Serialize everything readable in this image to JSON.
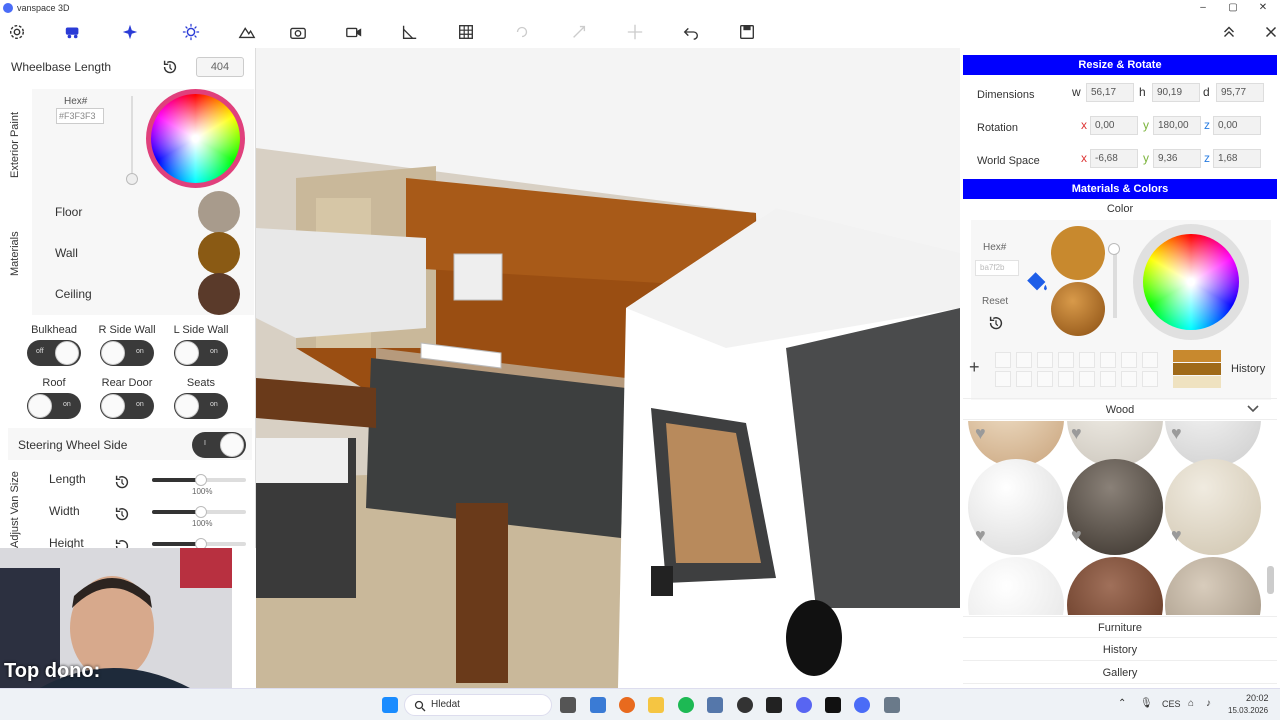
{
  "window": {
    "title": "vanspace 3D",
    "minimize": "–",
    "maximize": "▢",
    "close": "✕"
  },
  "toolbar": {
    "icons": [
      "settings-icon",
      "van-icon",
      "sparkle-icon",
      "sun-icon",
      "terrain-icon",
      "camera-icon",
      "video-icon",
      "measure-icon",
      "grid-icon",
      "redo-icon",
      "resize-icon",
      "move-icon",
      "undo-icon",
      "save-icon",
      "collapse-icon",
      "close-icon"
    ]
  },
  "left": {
    "wheelbase": {
      "label": "Wheelbase Length",
      "value": "404"
    },
    "exterior": {
      "section": "Exterior Paint",
      "hex_label": "Hex#",
      "hex_value": "#F3F3F3"
    },
    "materials": {
      "section": "Materials",
      "items": [
        {
          "label": "Floor",
          "color": "#a89b8c"
        },
        {
          "label": "Wall",
          "color": "#8a5a14"
        },
        {
          "label": "Ceiling",
          "color": "#5a3a2a"
        }
      ]
    },
    "toggles": [
      {
        "label": "Bulkhead",
        "state": "off"
      },
      {
        "label": "R Side Wall",
        "state": "on"
      },
      {
        "label": "L Side Wall",
        "state": "on"
      },
      {
        "label": "Roof",
        "state": "on"
      },
      {
        "label": "Rear Door",
        "state": "on"
      },
      {
        "label": "Seats",
        "state": "on"
      }
    ],
    "steering": {
      "label": "Steering Wheel Side",
      "knob": "I"
    },
    "size": {
      "section": "Adjust Van Size",
      "items": [
        {
          "label": "Length",
          "pct": "100%",
          "fraction": 1.0
        },
        {
          "label": "Width",
          "pct": "100%",
          "fraction": 1.0
        },
        {
          "label": "Height",
          "pct": "",
          "fraction": 1.0
        }
      ]
    }
  },
  "right": {
    "resize": {
      "title": "Resize & Rotate",
      "dimensions": {
        "label": "Dimensions",
        "w": "56,17",
        "h": "90,19",
        "d": "95,77"
      },
      "rotation": {
        "label": "Rotation",
        "x": "0,00",
        "y": "180,00",
        "z": "0,00"
      },
      "world": {
        "label": "World Space",
        "x": "-6,68",
        "y": "9,36",
        "z": "1,68"
      },
      "axes": {
        "w": "w",
        "h": "h",
        "d": "d",
        "x": "x",
        "y": "y",
        "z": "z"
      }
    },
    "materials": {
      "title": "Materials & Colors",
      "color_label": "Color",
      "hex_label": "Hex#",
      "hex_placeholder": "ba7f2b",
      "reset_label": "Reset",
      "plus": "+",
      "history_label": "History",
      "selected_color": "#c8892e"
    },
    "wood": {
      "label": "Wood"
    },
    "sections": {
      "furniture": "Furniture",
      "history": "History",
      "gallery": "Gallery"
    }
  },
  "webcam": {
    "overlay": "Top dono:"
  },
  "taskbar": {
    "search_placeholder": "Hledat",
    "lang": "CES",
    "time": "20:02",
    "date": "15.03.2026"
  }
}
